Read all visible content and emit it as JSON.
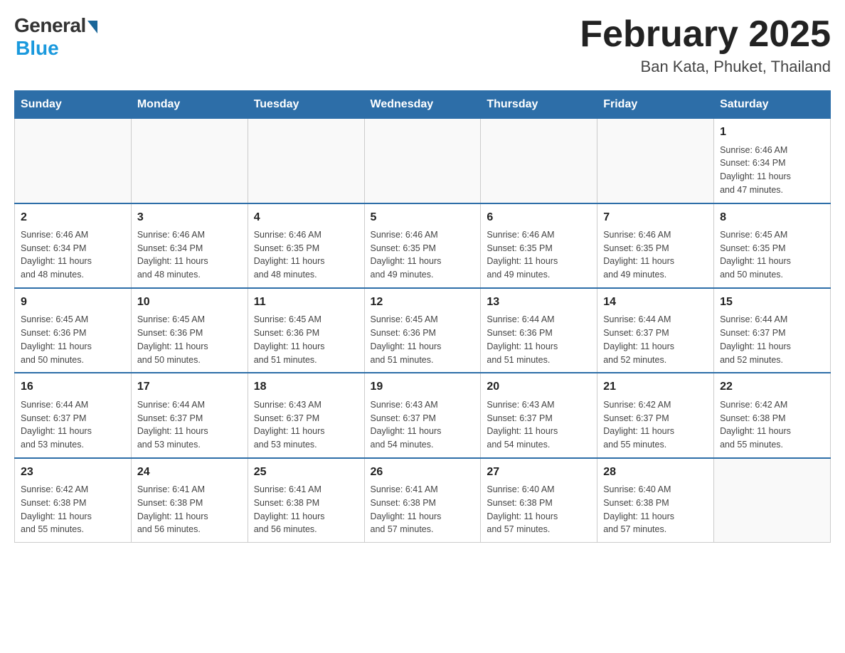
{
  "logo": {
    "general": "General",
    "blue": "Blue"
  },
  "title": {
    "month": "February 2025",
    "location": "Ban Kata, Phuket, Thailand"
  },
  "weekdays": [
    "Sunday",
    "Monday",
    "Tuesday",
    "Wednesday",
    "Thursday",
    "Friday",
    "Saturday"
  ],
  "weeks": [
    [
      {
        "day": "",
        "info": ""
      },
      {
        "day": "",
        "info": ""
      },
      {
        "day": "",
        "info": ""
      },
      {
        "day": "",
        "info": ""
      },
      {
        "day": "",
        "info": ""
      },
      {
        "day": "",
        "info": ""
      },
      {
        "day": "1",
        "info": "Sunrise: 6:46 AM\nSunset: 6:34 PM\nDaylight: 11 hours\nand 47 minutes."
      }
    ],
    [
      {
        "day": "2",
        "info": "Sunrise: 6:46 AM\nSunset: 6:34 PM\nDaylight: 11 hours\nand 48 minutes."
      },
      {
        "day": "3",
        "info": "Sunrise: 6:46 AM\nSunset: 6:34 PM\nDaylight: 11 hours\nand 48 minutes."
      },
      {
        "day": "4",
        "info": "Sunrise: 6:46 AM\nSunset: 6:35 PM\nDaylight: 11 hours\nand 48 minutes."
      },
      {
        "day": "5",
        "info": "Sunrise: 6:46 AM\nSunset: 6:35 PM\nDaylight: 11 hours\nand 49 minutes."
      },
      {
        "day": "6",
        "info": "Sunrise: 6:46 AM\nSunset: 6:35 PM\nDaylight: 11 hours\nand 49 minutes."
      },
      {
        "day": "7",
        "info": "Sunrise: 6:46 AM\nSunset: 6:35 PM\nDaylight: 11 hours\nand 49 minutes."
      },
      {
        "day": "8",
        "info": "Sunrise: 6:45 AM\nSunset: 6:35 PM\nDaylight: 11 hours\nand 50 minutes."
      }
    ],
    [
      {
        "day": "9",
        "info": "Sunrise: 6:45 AM\nSunset: 6:36 PM\nDaylight: 11 hours\nand 50 minutes."
      },
      {
        "day": "10",
        "info": "Sunrise: 6:45 AM\nSunset: 6:36 PM\nDaylight: 11 hours\nand 50 minutes."
      },
      {
        "day": "11",
        "info": "Sunrise: 6:45 AM\nSunset: 6:36 PM\nDaylight: 11 hours\nand 51 minutes."
      },
      {
        "day": "12",
        "info": "Sunrise: 6:45 AM\nSunset: 6:36 PM\nDaylight: 11 hours\nand 51 minutes."
      },
      {
        "day": "13",
        "info": "Sunrise: 6:44 AM\nSunset: 6:36 PM\nDaylight: 11 hours\nand 51 minutes."
      },
      {
        "day": "14",
        "info": "Sunrise: 6:44 AM\nSunset: 6:37 PM\nDaylight: 11 hours\nand 52 minutes."
      },
      {
        "day": "15",
        "info": "Sunrise: 6:44 AM\nSunset: 6:37 PM\nDaylight: 11 hours\nand 52 minutes."
      }
    ],
    [
      {
        "day": "16",
        "info": "Sunrise: 6:44 AM\nSunset: 6:37 PM\nDaylight: 11 hours\nand 53 minutes."
      },
      {
        "day": "17",
        "info": "Sunrise: 6:44 AM\nSunset: 6:37 PM\nDaylight: 11 hours\nand 53 minutes."
      },
      {
        "day": "18",
        "info": "Sunrise: 6:43 AM\nSunset: 6:37 PM\nDaylight: 11 hours\nand 53 minutes."
      },
      {
        "day": "19",
        "info": "Sunrise: 6:43 AM\nSunset: 6:37 PM\nDaylight: 11 hours\nand 54 minutes."
      },
      {
        "day": "20",
        "info": "Sunrise: 6:43 AM\nSunset: 6:37 PM\nDaylight: 11 hours\nand 54 minutes."
      },
      {
        "day": "21",
        "info": "Sunrise: 6:42 AM\nSunset: 6:37 PM\nDaylight: 11 hours\nand 55 minutes."
      },
      {
        "day": "22",
        "info": "Sunrise: 6:42 AM\nSunset: 6:38 PM\nDaylight: 11 hours\nand 55 minutes."
      }
    ],
    [
      {
        "day": "23",
        "info": "Sunrise: 6:42 AM\nSunset: 6:38 PM\nDaylight: 11 hours\nand 55 minutes."
      },
      {
        "day": "24",
        "info": "Sunrise: 6:41 AM\nSunset: 6:38 PM\nDaylight: 11 hours\nand 56 minutes."
      },
      {
        "day": "25",
        "info": "Sunrise: 6:41 AM\nSunset: 6:38 PM\nDaylight: 11 hours\nand 56 minutes."
      },
      {
        "day": "26",
        "info": "Sunrise: 6:41 AM\nSunset: 6:38 PM\nDaylight: 11 hours\nand 57 minutes."
      },
      {
        "day": "27",
        "info": "Sunrise: 6:40 AM\nSunset: 6:38 PM\nDaylight: 11 hours\nand 57 minutes."
      },
      {
        "day": "28",
        "info": "Sunrise: 6:40 AM\nSunset: 6:38 PM\nDaylight: 11 hours\nand 57 minutes."
      },
      {
        "day": "",
        "info": ""
      }
    ]
  ]
}
